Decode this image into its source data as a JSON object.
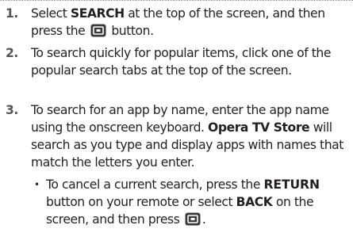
{
  "steps": [
    {
      "number": "1.",
      "parts": [
        "Select ",
        "SEARCH",
        " at the top of the screen, and then press the ",
        " button."
      ]
    },
    {
      "number": "2.",
      "text": "To search quickly for popular items, click one of the popular search tabs at the top of the screen."
    },
    {
      "number": "3.",
      "parts": [
        "To search for an app by name, enter the app name using the onscreen keyboard. ",
        "Opera TV Store",
        " will search as you type and display apps with names that match the letters you enter."
      ]
    }
  ],
  "sub_bullet": {
    "bullet": "•",
    "parts": [
      "To cancel a current search, press the ",
      "RETURN",
      " button on your remote or select ",
      "BACK",
      " on the screen, and then press ",
      "."
    ]
  },
  "icons": [
    "enter-button-icon"
  ]
}
